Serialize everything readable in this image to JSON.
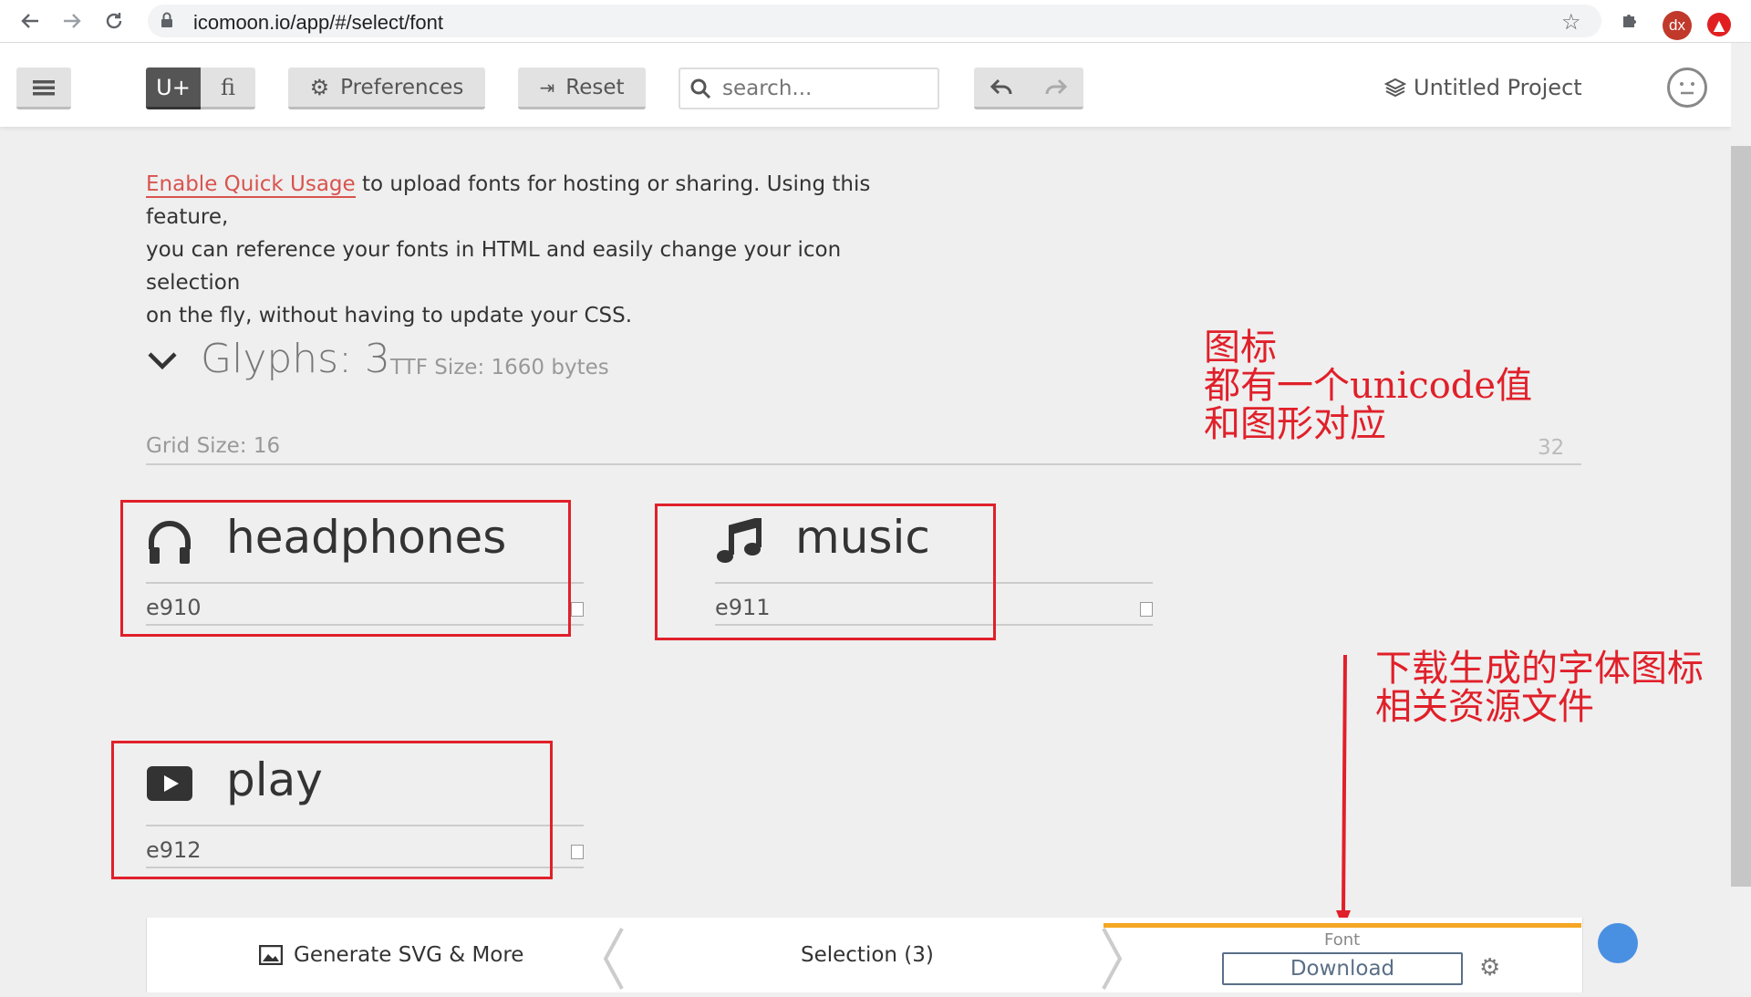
{
  "browser": {
    "url": "icomoon.io/app/#/select/font",
    "profile_initials": "dx"
  },
  "toolbar": {
    "unicode_toggle": "U+",
    "ligature_toggle": "fi",
    "preferences_label": "Preferences",
    "reset_label": "Reset",
    "search_placeholder": "search...",
    "project_name": "Untitled Project"
  },
  "quick_usage": {
    "link": "Enable Quick Usage",
    "line1_rest": " to upload fonts for hosting or sharing. Using this feature,",
    "line2": "you can reference your fonts in HTML and easily change your icon selection",
    "line3": "on the fly, without having to update your CSS."
  },
  "glyphs": {
    "title": "Glyphs: 3",
    "ttf_size": "TTF Size: 1660 bytes",
    "grid_size_label": "Grid Size: 16",
    "grid_max": "32",
    "items": [
      {
        "name": "headphones",
        "code": "e910",
        "icon": "headphones-icon"
      },
      {
        "name": "music",
        "code": "e911",
        "icon": "music-icon"
      },
      {
        "name": "play",
        "code": "e912",
        "icon": "play-icon"
      }
    ]
  },
  "annotations": {
    "a1_line1": "图标",
    "a1_line2": "都有一个unicode值",
    "a1_line3": "和图形对应",
    "a2_line1": "下载生成的字体图标",
    "a2_line2": "相关资源文件"
  },
  "footer": {
    "generate_label": "Generate SVG & More",
    "selection_label": "Selection (3)",
    "font_label": "Font",
    "download_label": "Download"
  },
  "colors": {
    "annotation_red": "#e0202a",
    "accent_orange": "#f5a623",
    "link_red": "#d9534f"
  }
}
